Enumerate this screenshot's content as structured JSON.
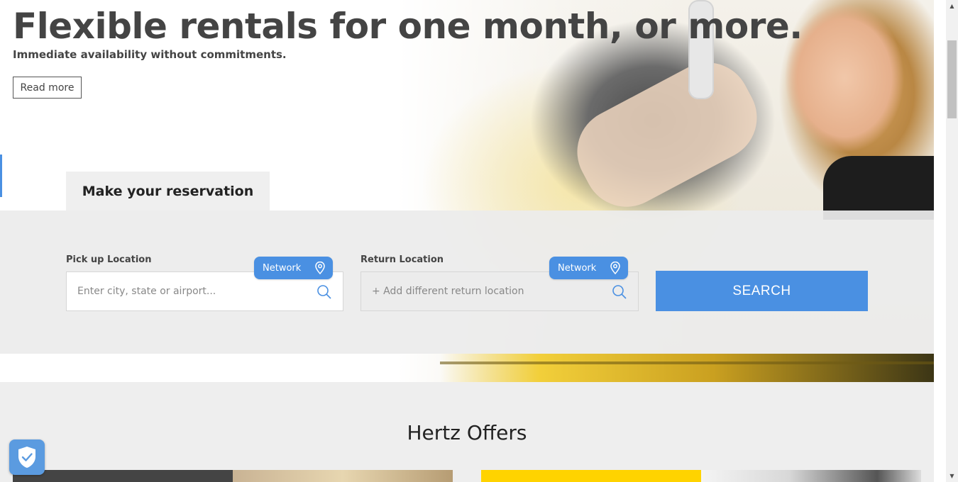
{
  "hero": {
    "title": "Flexible rentals for one month, or more.",
    "subtitle": "Immediate availability without commitments.",
    "read_more_label": "Read more"
  },
  "reservation": {
    "tab_label": "Make your reservation",
    "pickup": {
      "label": "Pick up Location",
      "placeholder": "Enter city, state or airport...",
      "network_label": "Network"
    },
    "return": {
      "label": "Return Location",
      "placeholder": "+ Add different return location",
      "network_label": "Network"
    },
    "search_label": "SEARCH"
  },
  "offers": {
    "title": "Hertz Offers"
  },
  "icons": {
    "search": "search-icon",
    "pin": "location-pin-icon",
    "shield": "shield-check-icon"
  },
  "colors": {
    "accent": "#4a90e2",
    "text": "#444444",
    "panel": "#ececec",
    "offer_yellow": "#ffd300"
  }
}
